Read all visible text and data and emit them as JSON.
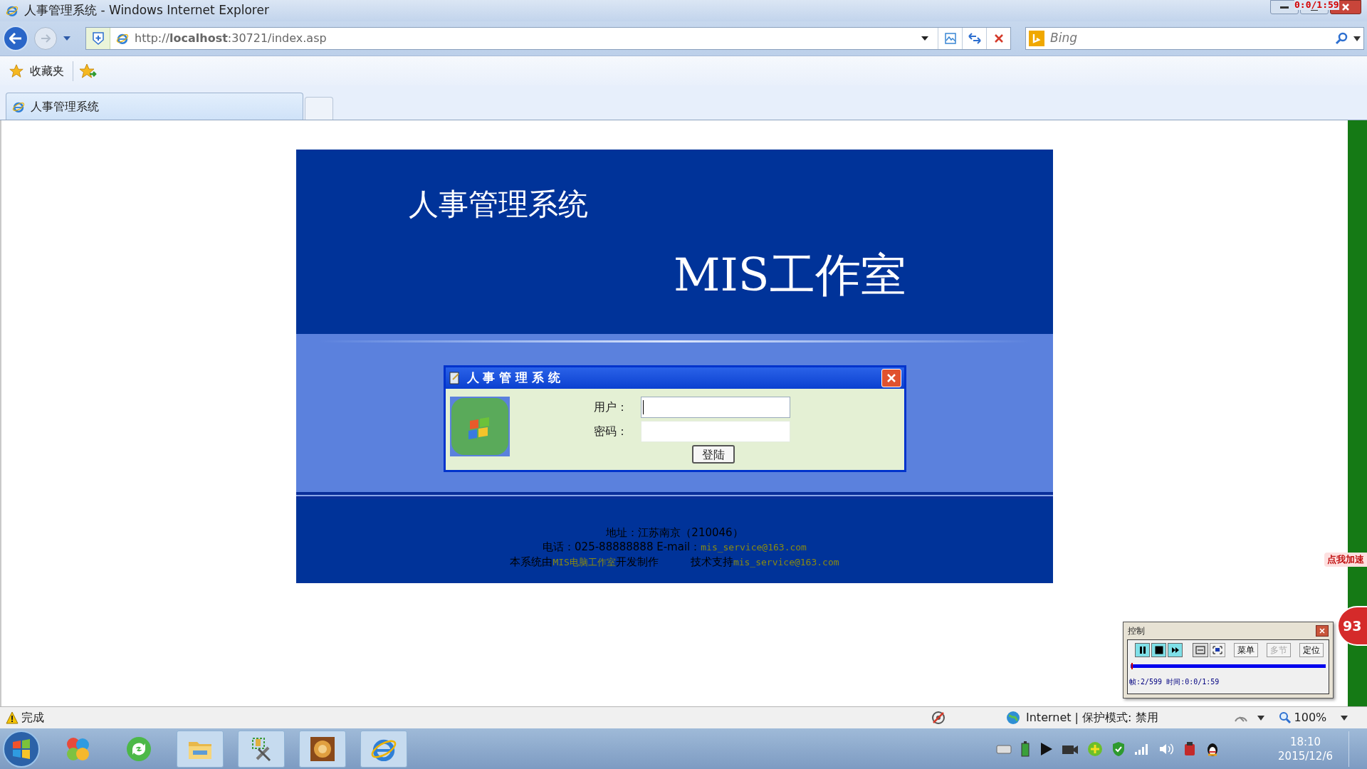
{
  "window": {
    "title": "人事管理系统 - Windows Internet Explorer"
  },
  "recorder_time": "0:0/1:59",
  "address_bar": {
    "url": "http://**localhost**:30721/index.asp"
  },
  "search": {
    "placeholder": "Bing"
  },
  "favorites": {
    "label": "收藏夹"
  },
  "tabs": [
    {
      "label": "人事管理系统",
      "selected": true
    }
  ],
  "page": {
    "title": "人事管理系统",
    "subtitle": "MIS工作室",
    "dialog": {
      "title": "人 事 管 理 系 统",
      "fields": [
        {
          "label": "用户：",
          "focused": true
        },
        {
          "label": "密码：",
          "focused": false
        }
      ],
      "button": "登陆"
    },
    "footer": [
      {
        "segments": [
          {
            "text": "地址：江苏南京（210046）",
            "kind": "plain"
          }
        ]
      },
      {
        "segments": [
          {
            "text": "电话：025-88888888 E-mail：",
            "kind": "plain"
          },
          {
            "text": "mis_service@163.com",
            "kind": "highlight"
          }
        ]
      },
      {
        "segments": [
          {
            "text": "本系统由",
            "kind": "plain"
          },
          {
            "text": "MIS电脑工作室",
            "kind": "highlight"
          },
          {
            "text": "开发制作　　　技术支持",
            "kind": "plain"
          },
          {
            "text": "mis_service@163.com",
            "kind": "highlight"
          }
        ]
      }
    ]
  },
  "control_panel": {
    "title": "控制",
    "buttons": [
      {
        "label": "菜单",
        "disabled": false
      },
      {
        "label": "多节",
        "disabled": true
      },
      {
        "label": "定位",
        "disabled": false
      }
    ],
    "level": 0.004,
    "readout": "帧:2/599 时间:0:0/1:59"
  },
  "gadget": {
    "label": "点我加速",
    "badge": "93"
  },
  "status_bar": {
    "text": "完成",
    "zone": "Internet | 保护模式: 禁用",
    "zoom": "100%"
  },
  "taskbar": {
    "apps": [
      {
        "kind": "balls",
        "running": false
      },
      {
        "kind": "refresh",
        "running": false
      },
      {
        "kind": "folder",
        "running": true
      },
      {
        "kind": "tools",
        "running": true
      },
      {
        "kind": "image",
        "running": true
      },
      {
        "kind": "browser",
        "running": true
      }
    ],
    "clock_time": "18:10",
    "clock_date": "2015/12/6"
  }
}
